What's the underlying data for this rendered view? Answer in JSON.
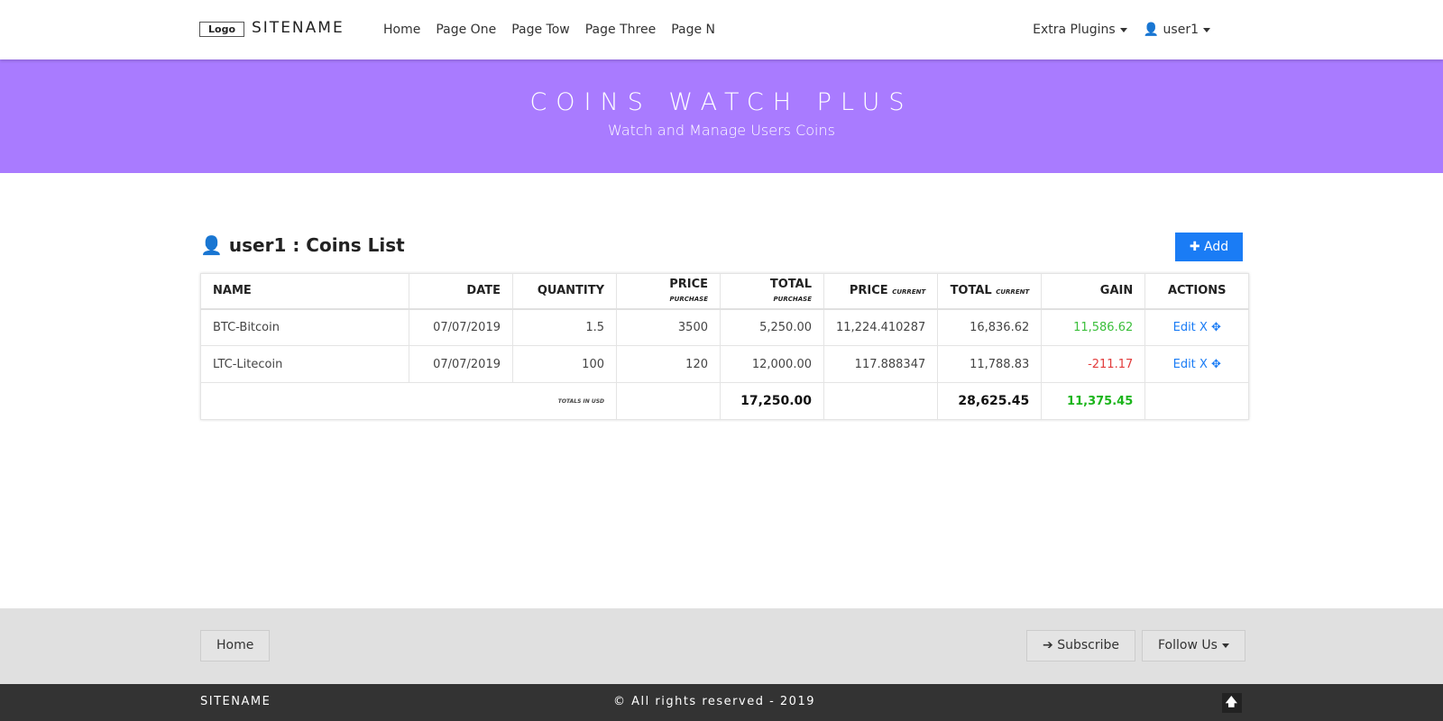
{
  "nav": {
    "logo": "Logo",
    "sitename": "SITENAME",
    "links": [
      "Home",
      "Page One",
      "Page Tow",
      "Page Three",
      "Page N"
    ],
    "extra": "Extra Plugins",
    "user": "user1"
  },
  "banner": {
    "title": "COINS WATCH PLUS",
    "subtitle": "Watch and Manage Users Coins"
  },
  "main": {
    "title": "user1 : Coins List",
    "add": "Add"
  },
  "table": {
    "headers": [
      {
        "main": "NAME",
        "sub": ""
      },
      {
        "main": "DATE",
        "sub": ""
      },
      {
        "main": "QUANTITY",
        "sub": ""
      },
      {
        "main": "PRICE",
        "sub": "purchase"
      },
      {
        "main": "TOTAL",
        "sub": "purchase"
      },
      {
        "main": "PRICE",
        "sub": "current"
      },
      {
        "main": "TOTAL",
        "sub": "current"
      },
      {
        "main": "GAIN",
        "sub": ""
      },
      {
        "main": "ACTIONS",
        "sub": ""
      }
    ],
    "rows": [
      [
        "BTC-Bitcoin",
        "07/07/2019",
        "1.5",
        "3500",
        "5,250.00",
        "11,224.410287",
        "16,836.62",
        "11,586.62"
      ],
      [
        "LTC-Litecoin",
        "07/07/2019",
        "100",
        "120",
        "12,000.00",
        "117.888347",
        "11,788.83",
        "-211.17"
      ]
    ],
    "edit": "Edit",
    "remove": "X",
    "totals_label": "TOTALS IN USD",
    "total_purchase": "17,250.00",
    "total_current": "28,625.45",
    "total_gain": "11,375.45"
  },
  "footer": {
    "home": "Home",
    "subscribe": "Subscribe",
    "follow": "Follow Us",
    "sitename": "SITENAME",
    "copyright": "© All rights reserved - 2019"
  }
}
